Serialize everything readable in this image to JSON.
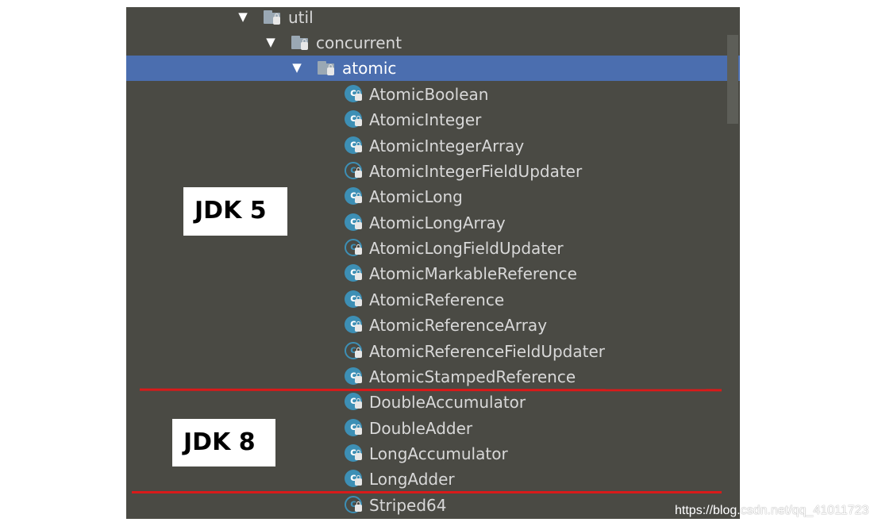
{
  "tree": {
    "packages": [
      {
        "label": "util",
        "arrow": "▼"
      },
      {
        "label": "concurrent",
        "arrow": "▼"
      },
      {
        "label": "atomic",
        "arrow": "▼"
      }
    ],
    "classes": [
      {
        "label": "AtomicBoolean",
        "abstract": false
      },
      {
        "label": "AtomicInteger",
        "abstract": false
      },
      {
        "label": "AtomicIntegerArray",
        "abstract": false
      },
      {
        "label": "AtomicIntegerFieldUpdater",
        "abstract": true
      },
      {
        "label": "AtomicLong",
        "abstract": false
      },
      {
        "label": "AtomicLongArray",
        "abstract": false
      },
      {
        "label": "AtomicLongFieldUpdater",
        "abstract": true
      },
      {
        "label": "AtomicMarkableReference",
        "abstract": false
      },
      {
        "label": "AtomicReference",
        "abstract": false
      },
      {
        "label": "AtomicReferenceArray",
        "abstract": false
      },
      {
        "label": "AtomicReferenceFieldUpdater",
        "abstract": true
      },
      {
        "label": "AtomicStampedReference",
        "abstract": false
      },
      {
        "label": "DoubleAccumulator",
        "abstract": false
      },
      {
        "label": "DoubleAdder",
        "abstract": false
      },
      {
        "label": "LongAccumulator",
        "abstract": false
      },
      {
        "label": "LongAdder",
        "abstract": false
      },
      {
        "label": "Striped64",
        "abstract": true
      }
    ],
    "class_icon_glyph": "c"
  },
  "annotations": {
    "jdk5": "JDK 5",
    "jdk8": "JDK 8"
  },
  "watermark": "https://blog.csdn.net/qq_41011723",
  "colors": {
    "panel_bg": "#4a4a44",
    "selection": "#4b6eaf",
    "class_icon": "#3d8fb5",
    "separator": "#d91a1a"
  }
}
